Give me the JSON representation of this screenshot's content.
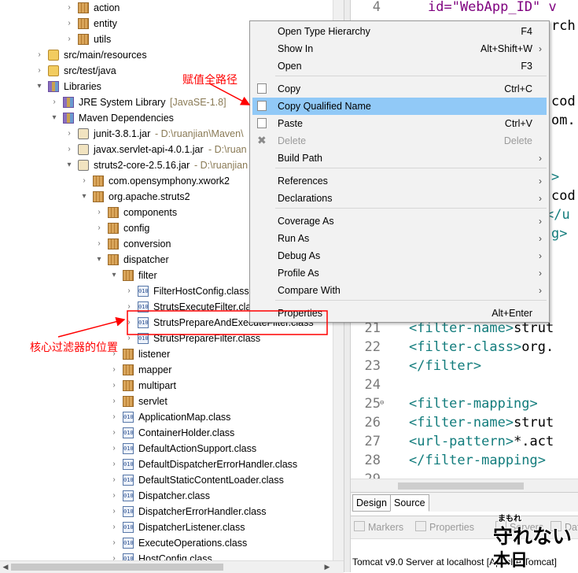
{
  "tree": {
    "rows": [
      {
        "label": "action",
        "icon": "package-icon"
      },
      {
        "label": "entity",
        "icon": "package-icon"
      },
      {
        "label": "utils",
        "icon": "package-icon"
      },
      {
        "label": "src/main/resources",
        "icon": "source-folder-icon"
      },
      {
        "label": "src/test/java",
        "icon": "source-folder-icon"
      },
      {
        "label": "Libraries",
        "icon": "library-icon"
      },
      {
        "label": "JRE System Library",
        "decor": "[JavaSE-1.8]",
        "icon": "library-icon"
      },
      {
        "label": "Maven Dependencies",
        "icon": "library-icon"
      },
      {
        "label": "junit-3.8.1.jar",
        "decor": "- D:\\ruanjian\\Maven\\",
        "icon": "jar-icon"
      },
      {
        "label": "javax.servlet-api-4.0.1.jar",
        "decor": "- D:\\ruan",
        "icon": "jar-icon"
      },
      {
        "label": "struts2-core-2.5.16.jar",
        "decor": "- D:\\ruanjian",
        "icon": "jar-icon"
      },
      {
        "label": "com.opensymphony.xwork2",
        "icon": "package-icon"
      },
      {
        "label": "org.apache.struts2",
        "icon": "package-icon"
      },
      {
        "label": "components",
        "icon": "package-icon"
      },
      {
        "label": "config",
        "icon": "package-icon"
      },
      {
        "label": "conversion",
        "icon": "package-icon"
      },
      {
        "label": "dispatcher",
        "icon": "package-icon"
      },
      {
        "label": "filter",
        "icon": "package-icon"
      },
      {
        "label": "FilterHostConfig.class",
        "icon": "class-file-icon"
      },
      {
        "label": "StrutsExecuteFilter.class",
        "icon": "class-file-icon"
      },
      {
        "label": "StrutsPrepareAndExecuteFilter.class",
        "icon": "class-file-icon"
      },
      {
        "label": "StrutsPrepareFilter.class",
        "icon": "class-file-icon"
      },
      {
        "label": "listener",
        "icon": "package-icon"
      },
      {
        "label": "mapper",
        "icon": "package-icon"
      },
      {
        "label": "multipart",
        "icon": "package-icon"
      },
      {
        "label": "servlet",
        "icon": "package-icon"
      },
      {
        "label": "ApplicationMap.class",
        "icon": "class-file-icon"
      },
      {
        "label": "ContainerHolder.class",
        "icon": "class-file-icon"
      },
      {
        "label": "DefaultActionSupport.class",
        "icon": "class-file-icon"
      },
      {
        "label": "DefaultDispatcherErrorHandler.class",
        "icon": "class-file-icon"
      },
      {
        "label": "DefaultStaticContentLoader.class",
        "icon": "class-file-icon"
      },
      {
        "label": "Dispatcher.class",
        "icon": "class-file-icon"
      },
      {
        "label": "DispatcherErrorHandler.class",
        "icon": "class-file-icon"
      },
      {
        "label": "DispatcherListener.class",
        "icon": "class-file-icon"
      },
      {
        "label": "ExecuteOperations.class",
        "icon": "class-file-icon"
      },
      {
        "label": "HostConfig.class",
        "icon": "class-file-icon"
      }
    ]
  },
  "context_menu": {
    "items": [
      {
        "label": "Open Type Hierarchy",
        "shortcut": "F4"
      },
      {
        "label": "Show In",
        "shortcut": "Alt+Shift+W",
        "submenu": true
      },
      {
        "label": "Open",
        "shortcut": "F3"
      },
      {
        "label": "Copy",
        "shortcut": "Ctrl+C",
        "icon": "copy-icon"
      },
      {
        "label": "Copy Qualified Name",
        "icon": "copy-qualified-name-icon",
        "selected": true
      },
      {
        "label": "Paste",
        "shortcut": "Ctrl+V",
        "icon": "paste-icon"
      },
      {
        "label": "Delete",
        "shortcut": "Delete",
        "icon": "delete-icon",
        "disabled": true
      },
      {
        "label": "Build Path",
        "submenu": true
      },
      {
        "label": "References",
        "submenu": true
      },
      {
        "label": "Declarations",
        "submenu": true
      },
      {
        "label": "Coverage As",
        "submenu": true
      },
      {
        "label": "Run As",
        "submenu": true
      },
      {
        "label": "Debug As",
        "submenu": true
      },
      {
        "label": "Profile As",
        "submenu": true
      },
      {
        "label": "Compare With",
        "submenu": true
      },
      {
        "label": "Properties",
        "shortcut": "Alt+Enter"
      }
    ]
  },
  "editor": {
    "partial_lines": [
      {
        "text": "id=\"WebApp_ID\" v"
      },
      {
        "text": "rch"
      },
      {
        "text": "cod"
      },
      {
        "text": "om."
      },
      {
        "text": ">"
      },
      {
        "text": "cod"
      },
      {
        "text": "</u"
      },
      {
        "text": "g>"
      }
    ],
    "first_line_number": "4",
    "lines": [
      {
        "n": "21",
        "open": "<filter-name>",
        "rest": "strut"
      },
      {
        "n": "22",
        "open": "<filter-class>",
        "rest": "org."
      },
      {
        "n": "23",
        "open": "</filter>",
        "rest": ""
      },
      {
        "n": "24",
        "open": "",
        "rest": ""
      },
      {
        "n": "25",
        "open": "<filter-mapping>",
        "rest": "",
        "fold": true
      },
      {
        "n": "26",
        "open": "<filter-name>",
        "rest": "strut"
      },
      {
        "n": "27",
        "open": "<url-pattern>",
        "rest": "*.act"
      },
      {
        "n": "28",
        "open": "</filter-mapping>",
        "rest": ""
      },
      {
        "n": "29",
        "open": "",
        "rest": ""
      }
    ],
    "tabs": {
      "design": "Design",
      "source": "Source"
    }
  },
  "views": {
    "markers": "Markers",
    "properties": "Properties",
    "servers": "Servers",
    "data": "Data"
  },
  "server_line": "Tomcat v9.0 Server at localhost [Apache Tomcat]",
  "watermark": {
    "main": "守れない",
    "small": "まもれ",
    "sub": "本日"
  },
  "annotations": {
    "copy_path": "赋值全路径",
    "core_filter": "核心过滤器的位置"
  },
  "colors": {
    "annotation": "#ff0000",
    "menu_selection": "#91c9f7",
    "xml_tag": "#127c7c",
    "xml_value": "#2a00ff"
  }
}
